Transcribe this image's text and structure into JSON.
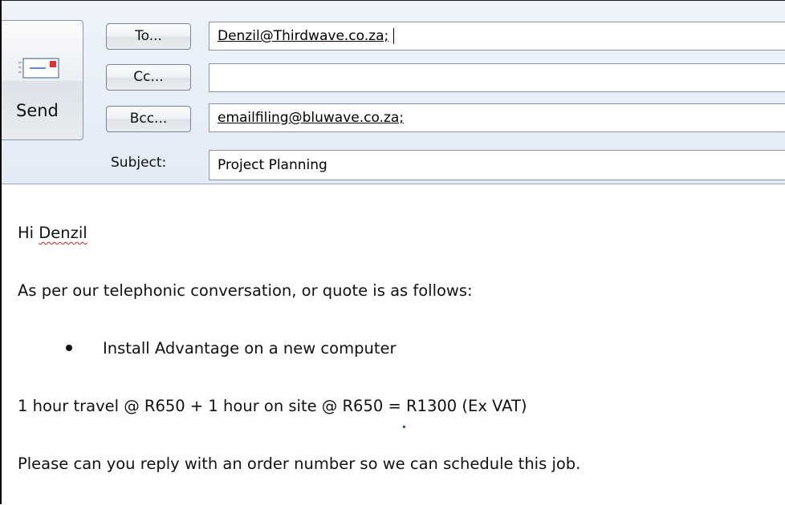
{
  "send": {
    "label": "Send",
    "icon": "envelope-send-icon"
  },
  "recipients": {
    "to_label": "To...",
    "to_value": "Denzil@Thirdwave.co.za;",
    "cc_label": "Cc...",
    "cc_value": "",
    "bcc_label": "Bcc...",
    "bcc_value": "emailfiling@bluwave.co.za;"
  },
  "subject": {
    "label": "Subject:",
    "value": "Project Planning"
  },
  "body": {
    "greeting_prefix": "Hi ",
    "greeting_name": "Denzil",
    "intro": "As per our telephonic conversation, or quote is as follows:",
    "bullets": [
      "Install Advantage on a new computer"
    ],
    "pricing": "1 hour travel @ R650 + 1 hour on site @ R650 = R1300 (Ex VAT)",
    "request": "Please can you reply with an  order number so we can schedule this job."
  },
  "colors": {
    "header_bg": "#e3ebf6",
    "spellcheck_underline": "#d0202a",
    "send_icon_accent": "#e03030"
  }
}
